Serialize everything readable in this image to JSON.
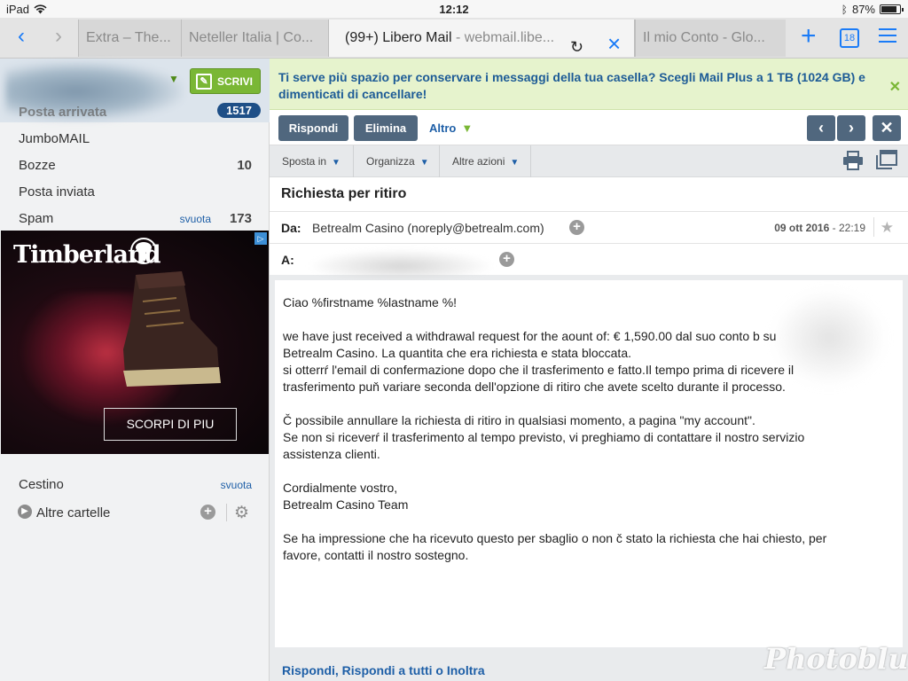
{
  "status_bar": {
    "device": "iPad",
    "time": "12:12",
    "battery": "87%"
  },
  "browser": {
    "tabs": [
      {
        "title": "Extra – The..."
      },
      {
        "title": "Neteller Italia | Co..."
      },
      {
        "title": "(99+) Libero Mail",
        "url": "- webmail.libe..."
      },
      {
        "title": "Il mio Conto - Glo..."
      }
    ],
    "tab_count": "18"
  },
  "sidebar": {
    "compose_label": "SCRIVI",
    "inbox": {
      "label": "Posta arrivata",
      "count": "1517"
    },
    "folders": [
      {
        "label": "JumboMAIL",
        "count": ""
      },
      {
        "label": "Bozze",
        "count": "10"
      },
      {
        "label": "Posta inviata",
        "count": ""
      },
      {
        "label": "Spam",
        "empty_link": "svuota",
        "count": "173"
      }
    ],
    "trash": {
      "label": "Cestino",
      "empty_link": "svuota"
    },
    "other_folders": "Altre cartelle"
  },
  "ad": {
    "brand": "Timberland",
    "cta": "SCORPI DI PIU"
  },
  "promo": {
    "text": "Ti serve più spazio per conservare i messaggi della tua casella? Scegli Mail Plus a 1 TB (1024 GB) e dimenticati di cancellare!"
  },
  "toolbar": {
    "reply": "Rispondi",
    "delete": "Elimina",
    "more": "Altro"
  },
  "menu": {
    "move": "Sposta in",
    "organize": "Organizza",
    "other_actions": "Altre azioni"
  },
  "message": {
    "subject": "Richiesta per ritiro",
    "from_label": "Da:",
    "from": "Betrealm Casino (noreply@betrealm.com)",
    "date": "09 ott 2016",
    "time": "22:19",
    "to_label": "A:",
    "body": {
      "greeting": "Ciao %firstname %lastname %!",
      "p1_line1": "we have just received a withdrawal request for the aount of: € 1,590.00 dal suo conto b          su",
      "p1_line2": "Betrealm Casino. La quantita che era richiesta e stata bloccata.",
      "p1_line3": "si otterrŕ l'email di confermazione dopo che il trasferimento e fatto.Il tempo prima di ricevere il",
      "p1_line4": "trasferimento puň variare seconda dell'opzione di ritiro che avete scelto durante il processo.",
      "p2_line1": "Č possibile annullare la richiesta di ritiro in qualsiasi momento, a pagina \"my account\".",
      "p2_line2": "Se non si riceverŕ il trasferimento al tempo previsto, vi preghiamo di contattare il nostro servizio",
      "p2_line3": "assistenza clienti.",
      "closing1": "Cordialmente vostro,",
      "closing2": "Betrealm Casino Team",
      "p3_line1": "Se ha impressione che ha ricevuto questo per sbaglio o non č stato la richiesta che hai chiesto, per",
      "p3_line2": "favore, contatti il nostro sostegno."
    }
  },
  "footer": {
    "reply_links": "Rispondi, Rispondi a tutti o Inoltra"
  },
  "watermark": "Photoblur"
}
